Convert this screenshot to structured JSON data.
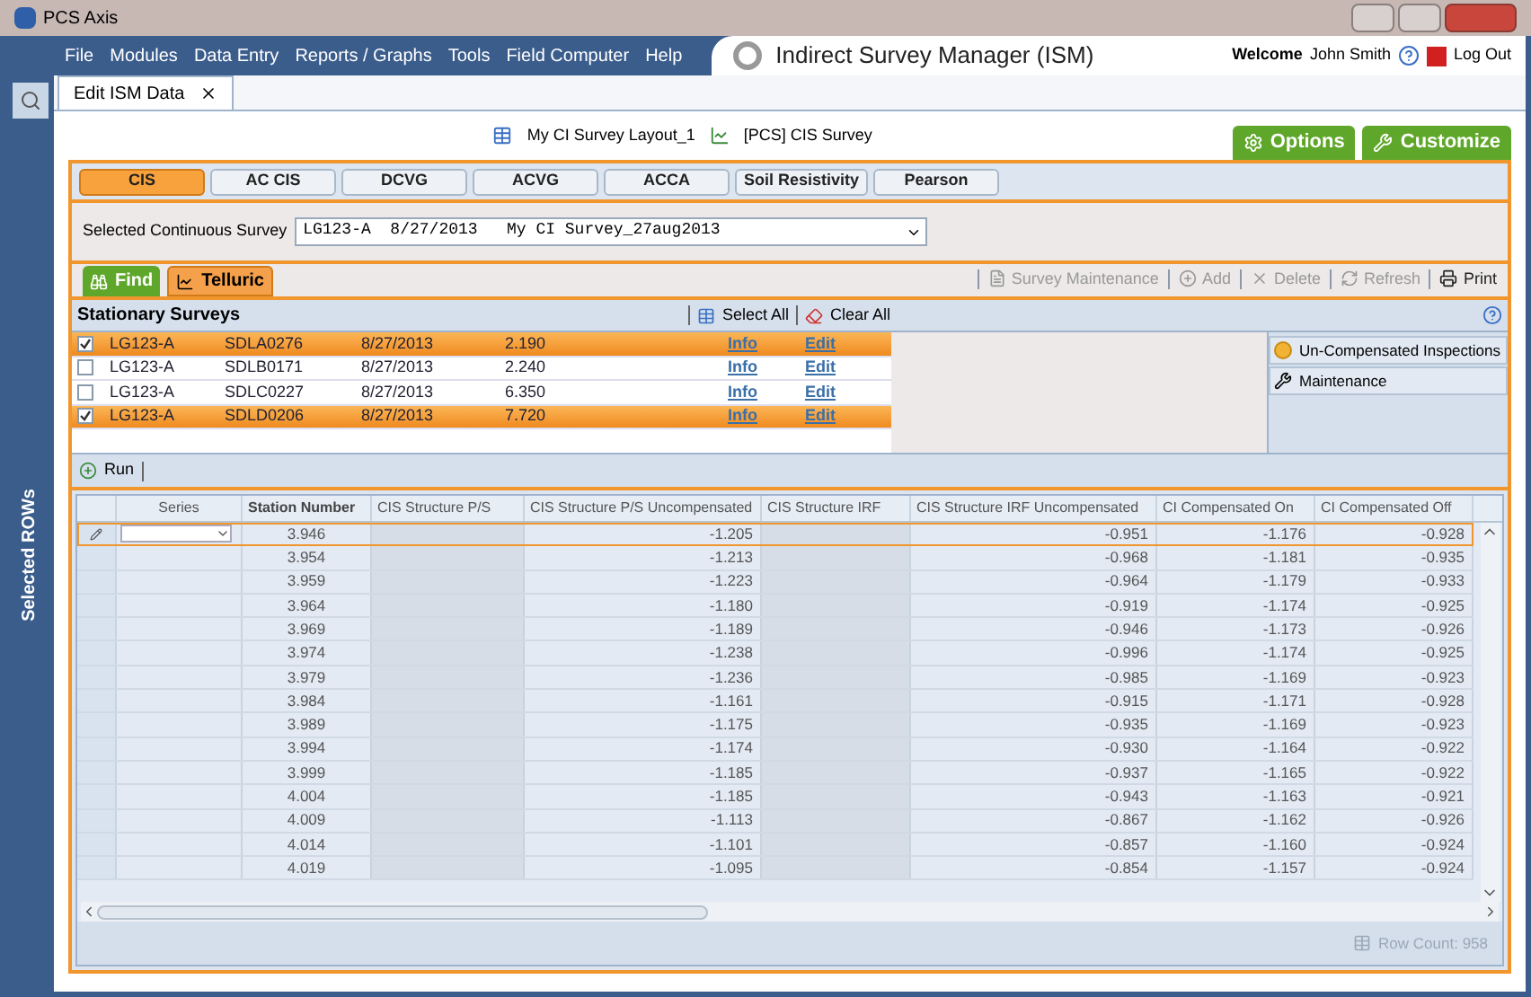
{
  "window": {
    "title": "PCS Axis"
  },
  "menu": [
    "File",
    "Modules",
    "Data Entry",
    "Reports / Graphs",
    "Tools",
    "Field Computer",
    "Help"
  ],
  "app_title": "Indirect Survey Manager (ISM)",
  "user": {
    "welcome": "Welcome",
    "name": "John Smith",
    "logout": "Log Out"
  },
  "side_panel": {
    "label": "Selected ROWs"
  },
  "doc_tab": {
    "label": "Edit ISM Data"
  },
  "layout": {
    "layout_name": "My CI Survey Layout_1",
    "survey_name": "[PCS] CIS Survey"
  },
  "top_buttons": [
    "Options",
    "Customize"
  ],
  "survey_tabs": [
    {
      "label": "CIS",
      "selected": true
    },
    {
      "label": "AC CIS",
      "selected": false
    },
    {
      "label": "DCVG",
      "selected": false
    },
    {
      "label": "ACVG",
      "selected": false
    },
    {
      "label": "ACCA",
      "selected": false
    },
    {
      "label": "Soil Resistivity",
      "selected": false
    },
    {
      "label": "Pearson",
      "selected": false
    }
  ],
  "survey_select": {
    "label": "Selected Continuous Survey",
    "value": "LG123-A  8/27/2013   My CI Survey_27aug2013"
  },
  "mode_tabs": [
    {
      "label": "Find",
      "kind": "find",
      "selected": false
    },
    {
      "label": "Telluric",
      "kind": "telluric",
      "selected": true
    }
  ],
  "toolbar": [
    {
      "label": "Survey Maintenance",
      "kind": "maintenance"
    },
    {
      "label": "Add",
      "kind": "add"
    },
    {
      "label": "Delete",
      "kind": "delete"
    },
    {
      "label": "Refresh",
      "kind": "refresh"
    },
    {
      "label": "Print",
      "kind": "print"
    }
  ],
  "stationary": {
    "title": "Stationary Surveys",
    "select_all": "Select All",
    "clear_all": "Clear All",
    "rows": [
      {
        "checked": true,
        "cells": [
          "LG123-A",
          "SDLA0276",
          "8/27/2013",
          "2.190"
        ],
        "info": "Info",
        "edit": "Edit"
      },
      {
        "checked": false,
        "cells": [
          "LG123-A",
          "SDLB0171",
          "8/27/2013",
          "2.240"
        ],
        "info": "Info",
        "edit": "Edit"
      },
      {
        "checked": false,
        "cells": [
          "LG123-A",
          "SDLC0227",
          "8/27/2013",
          "6.350"
        ],
        "info": "Info",
        "edit": "Edit"
      },
      {
        "checked": true,
        "cells": [
          "LG123-A",
          "SDLD0206",
          "8/27/2013",
          "7.720"
        ],
        "info": "Info",
        "edit": "Edit"
      }
    ],
    "actions": [
      {
        "label": "Un-Compensated Inspections",
        "kind": "inspections"
      },
      {
        "label": "Maintenance",
        "kind": "maintenance"
      }
    ]
  },
  "run_button": "Run",
  "grid": {
    "columns": [
      "Series",
      "Station Number",
      "CIS Structure P/S",
      "CIS Structure P/S Uncompensated",
      "CIS Structure IRF",
      "CIS Structure IRF Uncompensated",
      "CI Compensated On",
      "CI Compensated Off"
    ],
    "rows": [
      {
        "selected": true,
        "values": [
          "3.946",
          "-1.205",
          "-0.951",
          "-1.176",
          "-0.928"
        ]
      },
      {
        "selected": false,
        "values": [
          "3.954",
          "-1.213",
          "-0.968",
          "-1.181",
          "-0.935"
        ]
      },
      {
        "selected": false,
        "values": [
          "3.959",
          "-1.223",
          "-0.964",
          "-1.179",
          "-0.933"
        ]
      },
      {
        "selected": false,
        "values": [
          "3.964",
          "-1.180",
          "-0.919",
          "-1.174",
          "-0.925"
        ]
      },
      {
        "selected": false,
        "values": [
          "3.969",
          "-1.189",
          "-0.946",
          "-1.173",
          "-0.926"
        ]
      },
      {
        "selected": false,
        "values": [
          "3.974",
          "-1.238",
          "-0.996",
          "-1.174",
          "-0.925"
        ]
      },
      {
        "selected": false,
        "values": [
          "3.979",
          "-1.236",
          "-0.985",
          "-1.169",
          "-0.923"
        ]
      },
      {
        "selected": false,
        "values": [
          "3.984",
          "-1.161",
          "-0.915",
          "-1.171",
          "-0.928"
        ]
      },
      {
        "selected": false,
        "values": [
          "3.989",
          "-1.175",
          "-0.935",
          "-1.169",
          "-0.923"
        ]
      },
      {
        "selected": false,
        "values": [
          "3.994",
          "-1.174",
          "-0.930",
          "-1.164",
          "-0.922"
        ]
      },
      {
        "selected": false,
        "values": [
          "3.999",
          "-1.185",
          "-0.937",
          "-1.165",
          "-0.922"
        ]
      },
      {
        "selected": false,
        "values": [
          "4.004",
          "-1.185",
          "-0.943",
          "-1.163",
          "-0.921"
        ]
      },
      {
        "selected": false,
        "values": [
          "4.009",
          "-1.113",
          "-0.867",
          "-1.162",
          "-0.926"
        ]
      },
      {
        "selected": false,
        "values": [
          "4.014",
          "-1.101",
          "-0.857",
          "-1.160",
          "-0.924"
        ]
      },
      {
        "selected": false,
        "values": [
          "4.019",
          "-1.095",
          "-0.854",
          "-1.157",
          "-0.924"
        ]
      }
    ],
    "row_count": "Row Count: 958"
  }
}
